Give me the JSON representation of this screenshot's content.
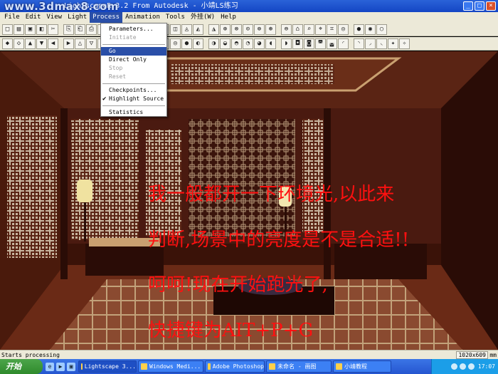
{
  "window": {
    "watermark": "www.3dmax8.com",
    "title": "LightscapeR 3.2 From Autodesk - 小靖LS练习",
    "buttons": [
      "_",
      "□",
      "×"
    ]
  },
  "menubar": {
    "items": [
      {
        "label": "File"
      },
      {
        "label": "Edit"
      },
      {
        "label": "View"
      },
      {
        "label": "Light"
      },
      {
        "label": "Process",
        "active": true
      },
      {
        "label": "Animation"
      },
      {
        "label": "Tools"
      },
      {
        "label": "外挂(W)"
      },
      {
        "label": "Help"
      }
    ]
  },
  "process_menu": {
    "items": [
      {
        "label": "Parameters...",
        "disabled": false
      },
      {
        "label": "Initiate",
        "disabled": true
      },
      {
        "separator": true
      },
      {
        "label": "Go",
        "selected": true
      },
      {
        "label": "Direct Only"
      },
      {
        "label": "Stop",
        "disabled": true
      },
      {
        "label": "Reset",
        "disabled": true
      },
      {
        "separator": true
      },
      {
        "label": "Checkpoints..."
      },
      {
        "label": "Highlight Source",
        "checked": true
      },
      {
        "separator": true
      },
      {
        "label": "Statistics"
      }
    ]
  },
  "overlay_text": {
    "line1": "我一般都开一下环境光,以此来",
    "line2": "判断,场景中的亮度是不是合适!!",
    "line3": "呵呵!现在开始跑光了,",
    "line4": "快捷键为AIT+P+G"
  },
  "statusbar": {
    "text": "Starts processing",
    "resolution": "1020x609",
    "unit": "mm"
  },
  "taskbar": {
    "start_label": "开始",
    "tasks": [
      {
        "label": "Lightscape 3...",
        "active": true
      },
      {
        "label": "Windows Medi..."
      },
      {
        "label": "Adobe Photoshop"
      },
      {
        "label": "未命名 - 画图"
      },
      {
        "label": "小靖教程"
      }
    ],
    "clock": "17:07"
  },
  "colors": {
    "overlay_text": "#ff1010",
    "menu_highlight": "#2a4fa8",
    "wood": "#4a1a10"
  }
}
